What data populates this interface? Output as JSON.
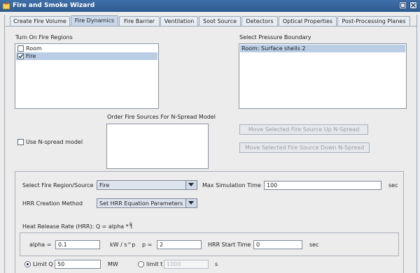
{
  "window": {
    "title": "Fire and Smoke Wizard"
  },
  "tabs": [
    {
      "label": "Create Fire Volume",
      "active": false
    },
    {
      "label": "Fire Dynamics",
      "active": true
    },
    {
      "label": "Fire Barrier",
      "active": false
    },
    {
      "label": "Ventilation",
      "active": false
    },
    {
      "label": "Soot Source",
      "active": false
    },
    {
      "label": "Detectors",
      "active": false
    },
    {
      "label": "Optical Properties",
      "active": false
    },
    {
      "label": "Post-Processing Planes",
      "active": false
    }
  ],
  "fire_regions": {
    "heading": "Turn On Fire Regions",
    "items": [
      {
        "label": "Room",
        "checked": false
      },
      {
        "label": "Fire",
        "checked": true
      }
    ]
  },
  "pressure_boundary": {
    "heading": "Select Pressure Boundary",
    "items": [
      "Room: Surface shells 2"
    ]
  },
  "n_spread": {
    "checkbox_label": "Use N-spread model",
    "checked": false,
    "order_heading": "Order Fire Sources For N-Spread Model",
    "move_up_label": "Move Selected Fire Source Up N-Spread",
    "move_down_label": "Move Selected Fire Source Down N-Spread"
  },
  "settings": {
    "region_label": "Select Fire Region/Source",
    "region_value": "Fire",
    "max_sim_label": "Max Simulation Time",
    "max_sim_value": "100",
    "max_sim_unit": "sec",
    "hrr_method_label": "HRR Creation Method",
    "hrr_method_value": "Set HRR Equation Parameters",
    "hrr_equation": "Heat Release Rate (HRR): Q = alpha * t",
    "hrr_exponent": "p",
    "alpha_label": "alpha =",
    "alpha_value": "0.1",
    "alpha_unit": "kW / s^p",
    "p_label": "p =",
    "p_value": "2",
    "start_label": "HRR Start Time",
    "start_value": "0",
    "start_unit": "sec",
    "limit_q_label": "Limit Q",
    "limit_q_value": "50",
    "limit_q_unit": "MW",
    "limit_q_selected": true,
    "limit_t_label": "limit t",
    "limit_t_value": "1000",
    "limit_t_unit": "s"
  },
  "colors": {
    "titlebar": "#3f6fa8",
    "selection": "#b9cde5",
    "active_tab": "#c9d7ea"
  }
}
